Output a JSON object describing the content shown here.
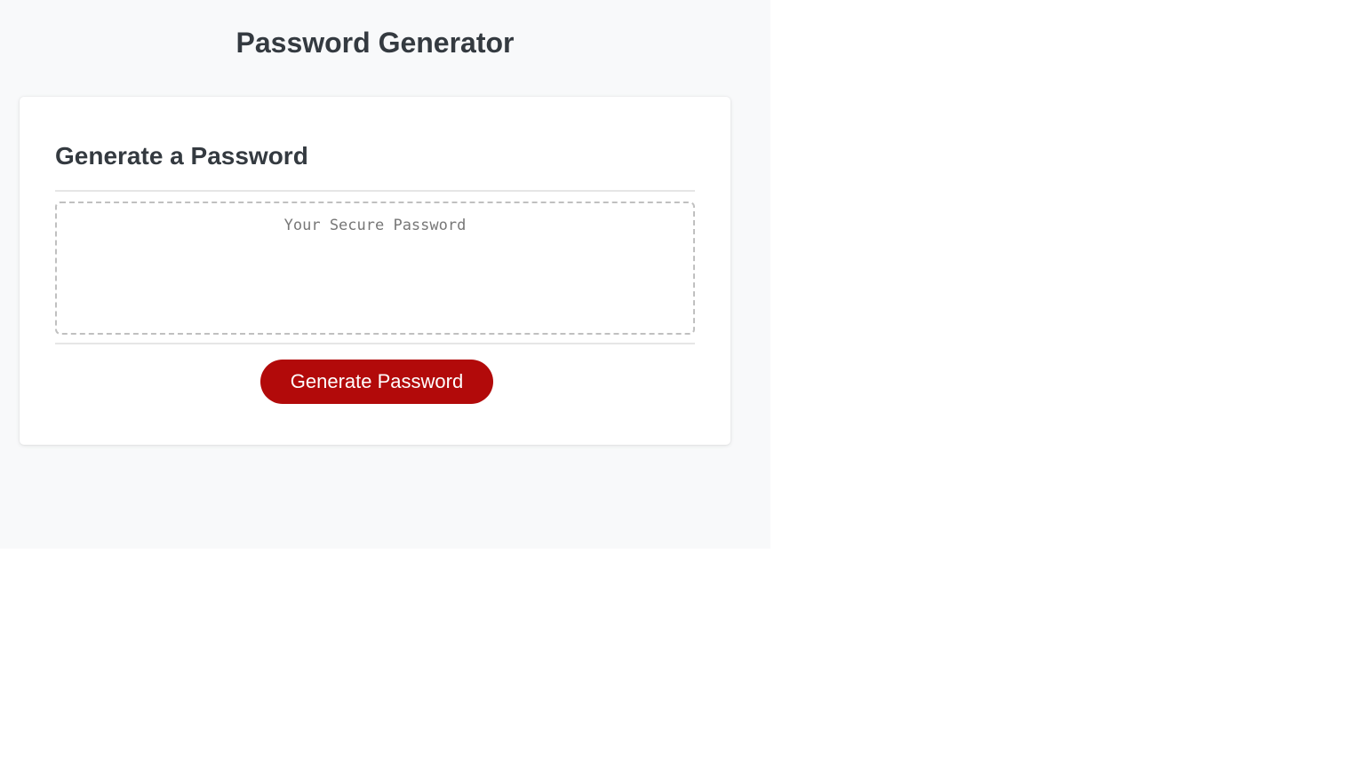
{
  "page": {
    "title": "Password Generator",
    "background_color": "#f8f9fa"
  },
  "card": {
    "header": "Generate a Password",
    "password_field": {
      "value": "",
      "placeholder": "Your Secure Password"
    },
    "generate_button": {
      "label": "Generate Password",
      "color": "#b20a0a"
    }
  }
}
